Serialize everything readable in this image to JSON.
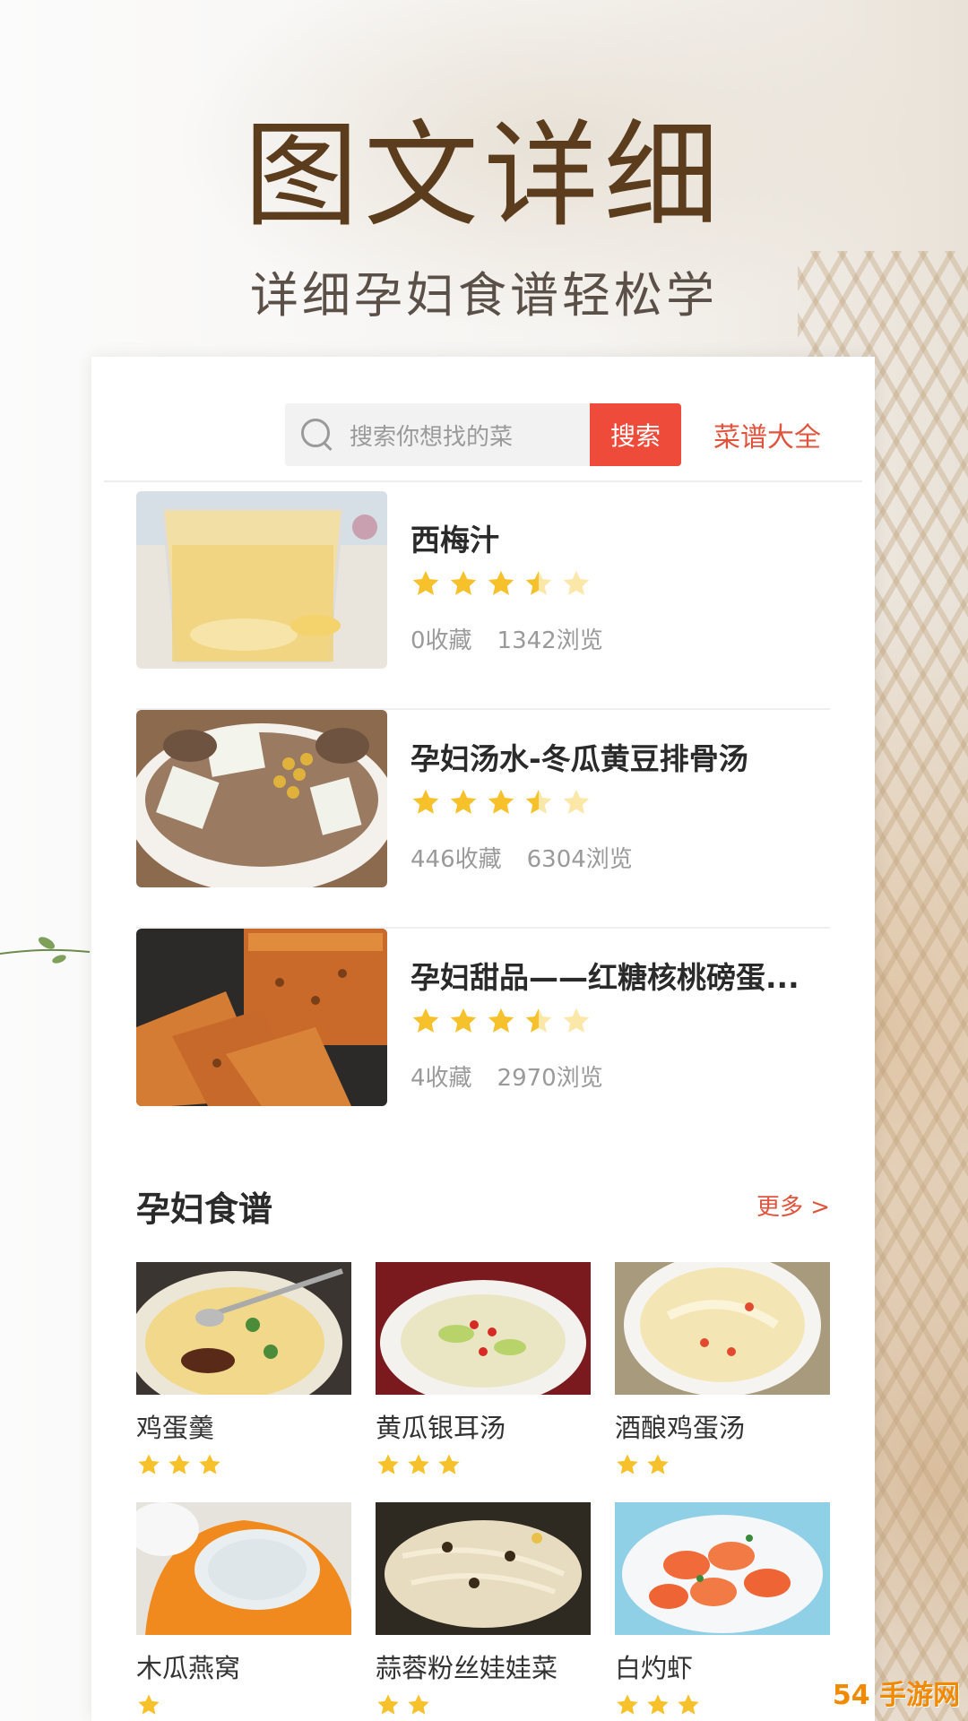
{
  "hero": {
    "title": "图文详细",
    "subtitle": "详细孕妇食谱轻松学"
  },
  "search": {
    "placeholder": "搜索你想找的菜",
    "button_label": "搜索",
    "catalog_link": "菜谱大全"
  },
  "recipes": [
    {
      "title": "西梅汁",
      "rating": 3.5,
      "favorites": "0收藏",
      "views": "1342浏览",
      "thumb": "plum-juice-image"
    },
    {
      "title": "孕妇汤水-冬瓜黄豆排骨汤",
      "rating": 3.5,
      "favorites": "446收藏",
      "views": "6304浏览",
      "thumb": "winter-melon-soup-image"
    },
    {
      "title": "孕妇甜品——红糖核桃磅蛋...",
      "rating": 3.5,
      "favorites": "4收藏",
      "views": "2970浏览",
      "thumb": "walnut-pound-cake-image"
    }
  ],
  "section": {
    "title": "孕妇食谱",
    "more_label": "更多 >"
  },
  "grid": [
    {
      "label": "鸡蛋羹",
      "stars": 3
    },
    {
      "label": "黄瓜银耳汤",
      "stars": 3
    },
    {
      "label": "酒酿鸡蛋汤",
      "stars": 2
    },
    {
      "label": "木瓜燕窝",
      "stars": 1
    },
    {
      "label": "蒜蓉粉丝娃娃菜",
      "stars": 2
    },
    {
      "label": "白灼虾",
      "stars": 3
    }
  ],
  "watermark": "54 手游网",
  "colors": {
    "accent": "#ef4b3a",
    "link": "#e0533c",
    "star": "#f6c12b",
    "hero_title": "#5b3d1e"
  }
}
